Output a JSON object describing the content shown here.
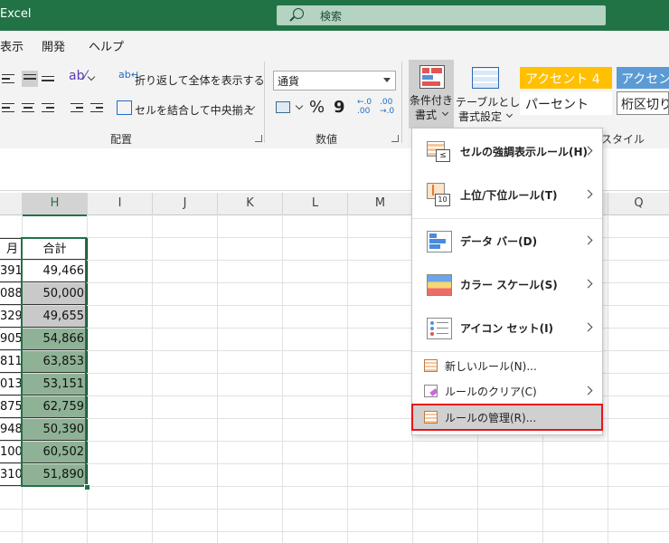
{
  "window": {
    "app_title": "Excel",
    "search_label": "検索"
  },
  "menu_tabs": [
    {
      "label": "表示"
    },
    {
      "label": "開発"
    },
    {
      "label": "ヘルプ"
    }
  ],
  "ribbon": {
    "wrap_text": "折り返して全体を表示する",
    "merge_center": "セルを結合して中央揃え",
    "group_alignment": "配置",
    "number_format": "通貨",
    "percent_symbol": "%",
    "comma_symbol": "9",
    "decimal_increase": "←.0 .00",
    "decimal_decrease": ".00 →.0",
    "group_number": "数値",
    "conditional_formatting": {
      "line1": "条件付き",
      "line2": "書式"
    },
    "format_as_table": {
      "line1": "テーブルとして",
      "line2": "書式設定"
    },
    "styles": {
      "accent4": "アクセント 4",
      "accent5": "アクセン",
      "percent": "パーセント",
      "comma": "桁区切り"
    },
    "group_styles": "スタイル"
  },
  "columns": [
    {
      "label": "H"
    },
    {
      "label": "I"
    },
    {
      "label": "J"
    },
    {
      "label": "K"
    },
    {
      "label": "L"
    },
    {
      "label": "M"
    },
    {
      "label": "Q"
    }
  ],
  "table": {
    "header_g_partial": "月",
    "header_total": "合計",
    "rows": [
      {
        "g": "391",
        "total": "49,466",
        "fill": "#ffffff"
      },
      {
        "g": "088",
        "total": "50,000",
        "fill": "#c9c9c9"
      },
      {
        "g": "329",
        "total": "49,655",
        "fill": "#c9c9c9"
      },
      {
        "g": "905",
        "total": "54,866",
        "fill": "#8fb296"
      },
      {
        "g": "811",
        "total": "63,853",
        "fill": "#8fb296"
      },
      {
        "g": "013",
        "total": "53,151",
        "fill": "#8fb296"
      },
      {
        "g": "875",
        "total": "62,759",
        "fill": "#8fb296"
      },
      {
        "g": "948",
        "total": "50,390",
        "fill": "#8fb296"
      },
      {
        "g": "100",
        "total": "60,502",
        "fill": "#8fb296"
      },
      {
        "g": "310",
        "total": "51,890",
        "fill": "#8fb296"
      }
    ]
  },
  "cf_menu": {
    "highlight_rules": "セルの強調表示ルール(H)",
    "top_bottom_rules": "上位/下位ルール(T)",
    "data_bars": "データ バー(D)",
    "color_scales": "カラー スケール(S)",
    "icon_sets": "アイコン セット(I)",
    "new_rule": "新しいルール(N)...",
    "clear_rules": "ルールのクリア(C)",
    "manage_rules": "ルールの管理(R)..."
  },
  "colors": {
    "excel_green": "#217346",
    "highlight_border": "#e8141d",
    "accent4": "#ffc000",
    "accent5": "#5b9bd5"
  }
}
